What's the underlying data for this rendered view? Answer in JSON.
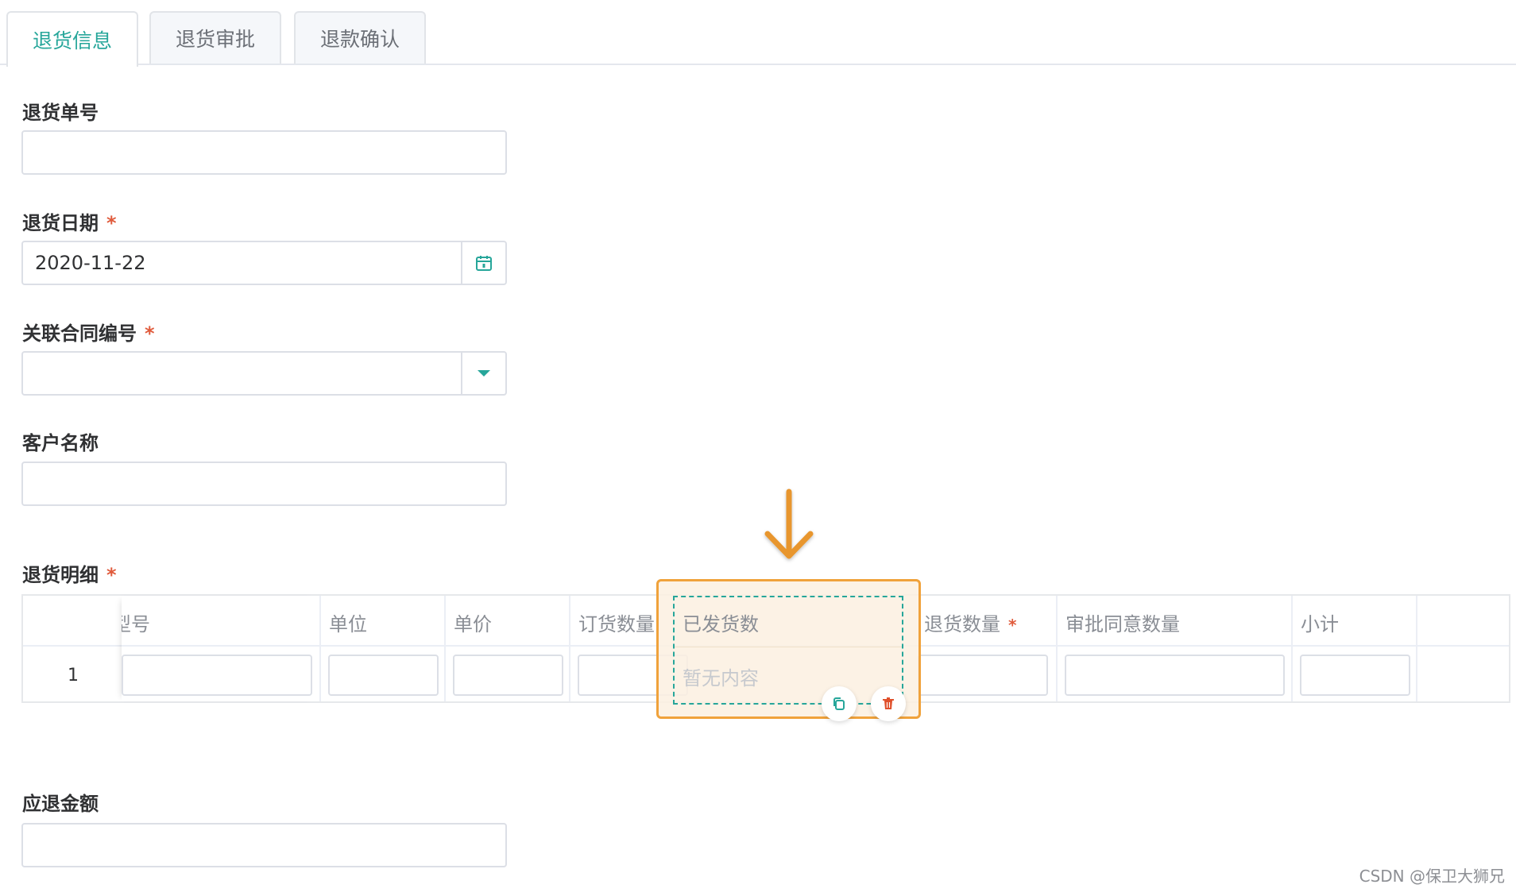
{
  "tabs": [
    {
      "label": "退货信息",
      "active": true
    },
    {
      "label": "退货审批",
      "active": false
    },
    {
      "label": "退款确认",
      "active": false
    }
  ],
  "form": {
    "return_no": {
      "label": "退货单号",
      "value": ""
    },
    "return_date": {
      "label": "退货日期",
      "required_mark": "*",
      "value": "2020-11-22",
      "suffix_icon": "calendar-icon"
    },
    "contract_no": {
      "label": "关联合同编号",
      "required_mark": "*",
      "value": "",
      "suffix_icon": "caret-down-icon"
    },
    "customer_name": {
      "label": "客户名称",
      "value": ""
    },
    "details": {
      "label": "退货明细",
      "required_mark": "*"
    },
    "refund_amount": {
      "label": "应退金额",
      "value": ""
    }
  },
  "table": {
    "columns": [
      "型号",
      "单位",
      "单价",
      "订货数量",
      "已发货数",
      "退货数量",
      "审批同意数量",
      "小计"
    ],
    "return_qty_required_mark": "*",
    "rows": [
      {
        "index": "1"
      }
    ]
  },
  "drag_card": {
    "title": "已发货数",
    "empty_text": "暂无内容",
    "copy_icon": "copy-icon",
    "delete_icon": "trash-icon",
    "border_color": "#f0a23b",
    "dash_color": "#26a69a"
  },
  "colors": {
    "accent": "#26a69a",
    "required": "#e05b3c",
    "drop_arrow": "#e8962d"
  },
  "watermark": "CSDN @保卫大狮兄"
}
